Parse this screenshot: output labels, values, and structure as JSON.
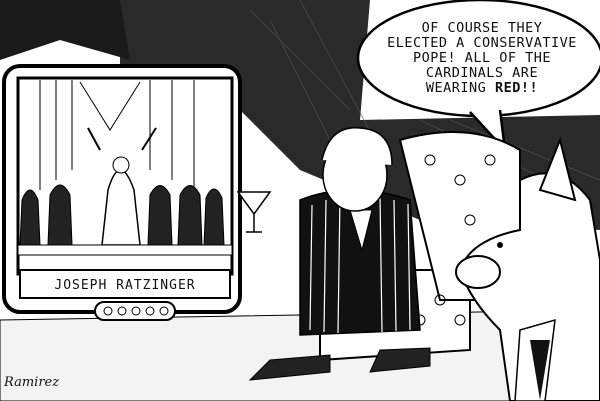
{
  "bubble": {
    "lines": [
      "OF COURSE THEY",
      "ELECTED A CONSERVATIVE",
      "POPE! ALL OF THE",
      "CARDINALS ARE",
      "WEARING "
    ],
    "emphasis": "RED!!"
  },
  "tv": {
    "caption": "JOSEPH RATZINGER"
  },
  "signature": "Ramirez",
  "icons": [
    "television",
    "martini-glass",
    "armchair",
    "donkey",
    "speech-bubble"
  ]
}
